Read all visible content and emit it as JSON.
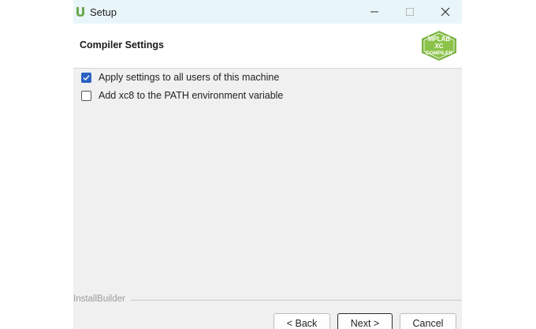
{
  "window": {
    "title": "Setup",
    "icon": "installbuilder-u-icon",
    "controls": {
      "minimize": "minimize-icon",
      "maximize": "maximize-icon",
      "close": "close-icon"
    }
  },
  "header": {
    "title": "Compiler Settings",
    "logo": {
      "top_text": "MPLAB",
      "middle_text": "XC",
      "bottom_text": "COMPILER"
    }
  },
  "options": [
    {
      "label": "Apply settings to all users of this machine",
      "checked": true
    },
    {
      "label": "Add xc8 to the PATH environment variable",
      "checked": false
    }
  ],
  "footer": {
    "brand": "InstallBuilder",
    "back_label": "< Back",
    "next_label": "Next >",
    "cancel_label": "Cancel"
  },
  "colors": {
    "titlebar_bg": "#e9f6f9",
    "checkbox_accent": "#2a62c4",
    "logo_green": "#7cb342",
    "icon_green": "#6aa84f"
  }
}
